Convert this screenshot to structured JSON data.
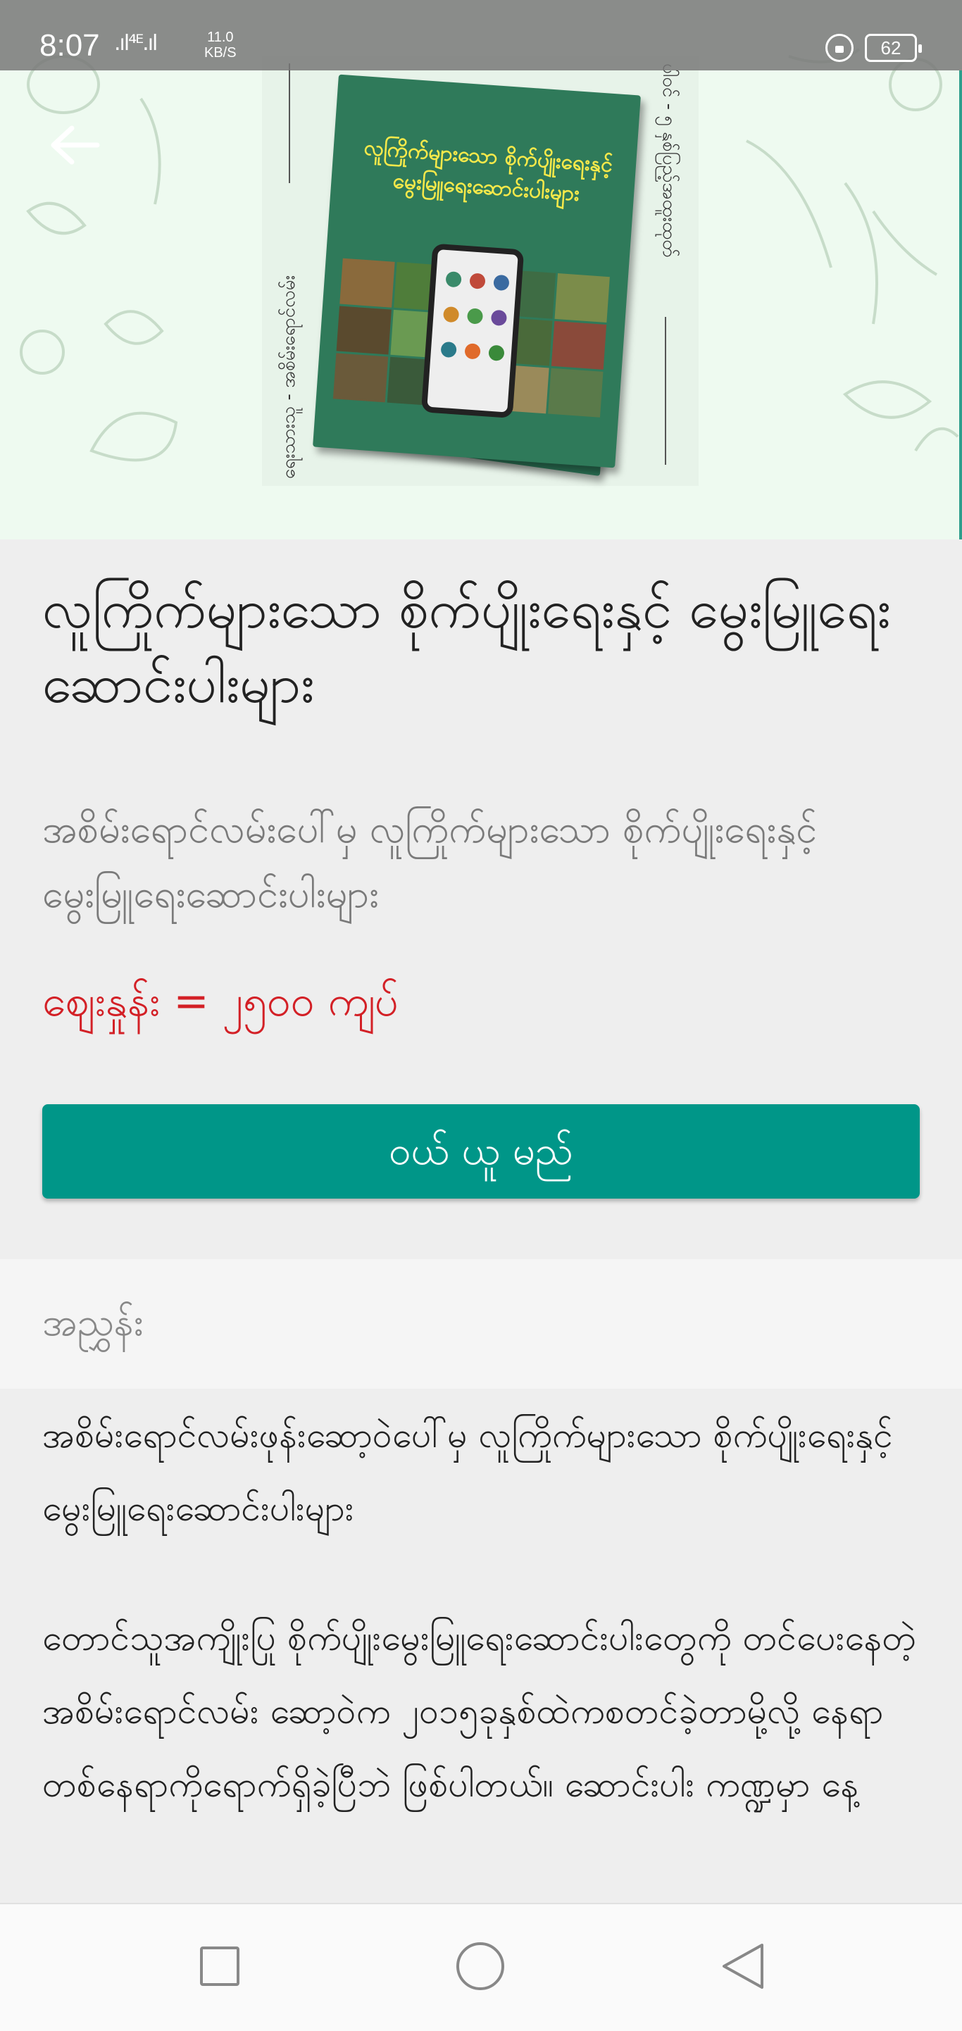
{
  "status_bar": {
    "time": "8:07",
    "signal": ".ıl⁴ᴱ.ıl",
    "speed_value": "11.0",
    "speed_unit": "KB/S",
    "battery": "62"
  },
  "hero": {
    "book_title": "လူကြိုက်များသော စိုက်ပျိုးရေးနှင့် မွေးမြူရေးဆောင်းပါးများ",
    "spine_left": "ရေးသားသူ - အစိမ်းရောင်လမ်း",
    "spine_right": "ပါဝင် - ၅ နှစ်ပြည့်အထူးထုတ်"
  },
  "product": {
    "title": "လူကြိုက်များသော စိုက်ပျိုးရေးနှင့် မွေးမြူရေးဆောင်းပါးများ",
    "subtitle": "အစိမ်းရောင်လမ်းပေါ်မှ လူကြိုက်များသော စိုက်ပျိုးရေးနှင့် မွေးမြူရေးဆောင်းပါးများ",
    "price": "ဈေးနှုန်း = ၂၅၀၀ ကျပ်",
    "buy_label": "ဝယ် ယူ မည်"
  },
  "description": {
    "header": "အညွှန်း",
    "paragraph1": "အစိမ်းရောင်လမ်းဖုန်းဆော့ဝဲပေါ်မှ လူကြိုက်များသော စိုက်ပျိုးရေးနှင့်မွေးမြူရေးဆောင်းပါးများ",
    "paragraph2": " တောင်သူအကျိုးပြု စိုက်ပျိုးမွေးမြူရေးဆောင်းပါးတွေကို တင်ပေးနေတဲ့ အစိမ်းရောင်လမ်း ဆော့ဝဲက ၂၀၁၅ခုနှစ်ထဲကစတင်ခဲ့တာမို့လို့ နေရာတစ်နေရာကိုရောက်ရှိခဲ့ပြီဘဲ ဖြစ်ပါတယ်။ ဆောင်းပါး ကဏ္ဍမှာ နေ့"
  },
  "colors": {
    "accent": "#009688",
    "price": "#d32026",
    "hero_bg": "#eefaf0"
  },
  "icons": {
    "back": "arrow-left-icon",
    "nav_recents": "square-icon",
    "nav_home": "circle-icon",
    "nav_back": "triangle-back-icon"
  }
}
